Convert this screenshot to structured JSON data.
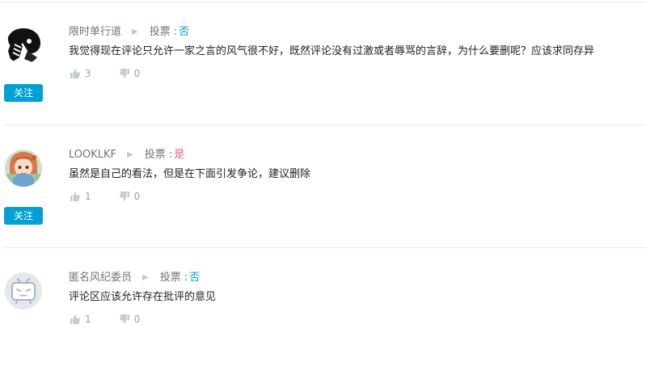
{
  "comments": [
    {
      "username": "限时单行道",
      "vote_label": "投票 : ",
      "vote_value": "否",
      "text": "我觉得现在评论只允许一家之言的风气很不好，既然评论没有过激或者辱骂的言辞，为什么要删呢？应该求同存异",
      "likes": "3",
      "dislikes": "0",
      "follow_label": "关注",
      "avatar_icon": "black-white-character-avatar"
    },
    {
      "username": "LOOKLKF",
      "vote_label": "投票 : ",
      "vote_value": "是",
      "text": "虽然是自己的看法，但是在下面引发争论，建议删除",
      "likes": "1",
      "dislikes": "0",
      "follow_label": "关注",
      "avatar_icon": "anime-girl-avatar"
    },
    {
      "username": "匿名风纪委员",
      "vote_label": "投票 : ",
      "vote_value": "否",
      "text": "评论区应该允许存在批评的意见",
      "likes": "1",
      "dislikes": "0",
      "avatar_icon": "tv-mascot-avatar"
    }
  ],
  "colors": {
    "accent_blue": "#00a1d6",
    "vote_yes_pink": "#f25d8e",
    "muted_gray": "#99a2aa",
    "divider": "#e5e9ef"
  }
}
